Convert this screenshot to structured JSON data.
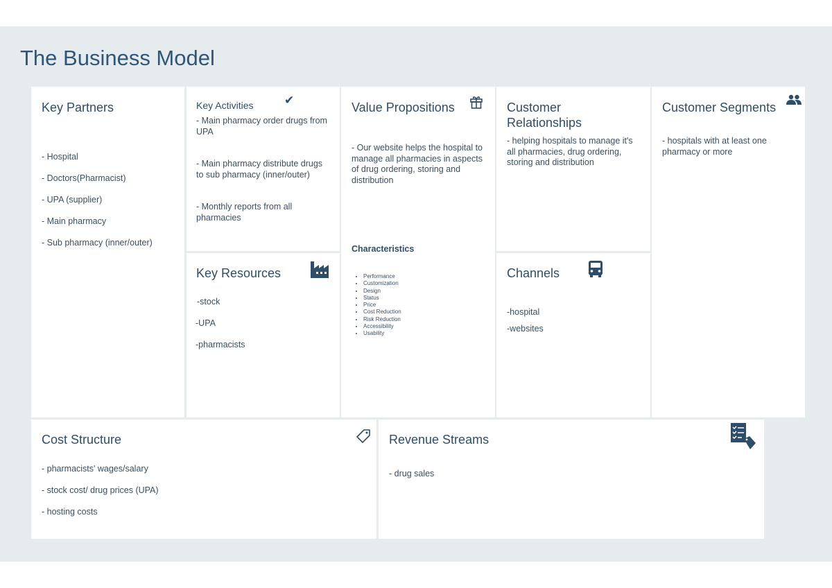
{
  "title": "The Business Model",
  "key_partners": {
    "title": "Key Partners",
    "items": [
      "- Hospital",
      "- Doctors(Pharmacist)",
      "- UPA (supplier)",
      "- Main pharmacy",
      "- Sub pharmacy (inner/outer)"
    ]
  },
  "key_activities": {
    "title": "Key Activities",
    "icon": "checkmark-icon",
    "items": [
      "- Main pharmacy order drugs from UPA",
      "- Main pharmacy distribute drugs to sub pharmacy (inner/outer)",
      "- Monthly reports from all pharmacies"
    ]
  },
  "key_resources": {
    "title": "Key Resources",
    "icon": "factory-icon",
    "items": [
      "-stock",
      "-UPA",
      "-pharmacists"
    ]
  },
  "value_propositions": {
    "title": "Value Propositions",
    "icon": "gift-icon",
    "text": "- Our website helps the hospital to manage all pharmacies in aspects of drug ordering, storing and distribution",
    "characteristics_title": "Characteristics",
    "characteristics": [
      "Performance",
      "Customization",
      "Design",
      "Status",
      "Price",
      "Cost Reduction",
      "Risk Reduction",
      "Accessibility",
      "Usability"
    ]
  },
  "customer_relationships": {
    "title": "Customer Relationships",
    "text": "- helping hospitals to manage it's all pharmacies, drug ordering, storing and distribution"
  },
  "channels": {
    "title": "Channels",
    "icon": "truck-icon",
    "items": [
      "-hospital",
      "-websites"
    ]
  },
  "customer_segments": {
    "title": "Customer Segments",
    "icon": "users-icon",
    "text": "- hospitals with at least one pharmacy or more"
  },
  "cost_structure": {
    "title": "Cost Structure",
    "icon": "tag-icon",
    "items": [
      "- pharmacists' wages/salary",
      "- stock cost/ drug prices (UPA)",
      "- hosting costs"
    ]
  },
  "revenue_streams": {
    "title": "Revenue Streams",
    "icon": "invoice-icon",
    "items": [
      "- drug sales"
    ]
  }
}
